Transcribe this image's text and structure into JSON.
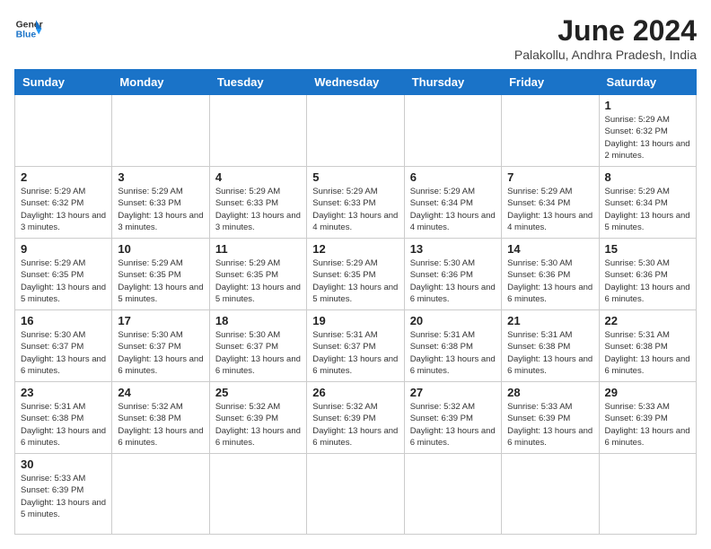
{
  "logo": {
    "line1": "General",
    "line2": "Blue"
  },
  "title": "June 2024",
  "subtitle": "Palakollu, Andhra Pradesh, India",
  "days_of_week": [
    "Sunday",
    "Monday",
    "Tuesday",
    "Wednesday",
    "Thursday",
    "Friday",
    "Saturday"
  ],
  "weeks": [
    [
      {
        "day": "",
        "info": ""
      },
      {
        "day": "",
        "info": ""
      },
      {
        "day": "",
        "info": ""
      },
      {
        "day": "",
        "info": ""
      },
      {
        "day": "",
        "info": ""
      },
      {
        "day": "",
        "info": ""
      },
      {
        "day": "1",
        "info": "Sunrise: 5:29 AM\nSunset: 6:32 PM\nDaylight: 13 hours and 2 minutes."
      }
    ],
    [
      {
        "day": "2",
        "info": "Sunrise: 5:29 AM\nSunset: 6:32 PM\nDaylight: 13 hours and 3 minutes."
      },
      {
        "day": "3",
        "info": "Sunrise: 5:29 AM\nSunset: 6:33 PM\nDaylight: 13 hours and 3 minutes."
      },
      {
        "day": "4",
        "info": "Sunrise: 5:29 AM\nSunset: 6:33 PM\nDaylight: 13 hours and 3 minutes."
      },
      {
        "day": "5",
        "info": "Sunrise: 5:29 AM\nSunset: 6:33 PM\nDaylight: 13 hours and 4 minutes."
      },
      {
        "day": "6",
        "info": "Sunrise: 5:29 AM\nSunset: 6:34 PM\nDaylight: 13 hours and 4 minutes."
      },
      {
        "day": "7",
        "info": "Sunrise: 5:29 AM\nSunset: 6:34 PM\nDaylight: 13 hours and 4 minutes."
      },
      {
        "day": "8",
        "info": "Sunrise: 5:29 AM\nSunset: 6:34 PM\nDaylight: 13 hours and 5 minutes."
      }
    ],
    [
      {
        "day": "9",
        "info": "Sunrise: 5:29 AM\nSunset: 6:35 PM\nDaylight: 13 hours and 5 minutes."
      },
      {
        "day": "10",
        "info": "Sunrise: 5:29 AM\nSunset: 6:35 PM\nDaylight: 13 hours and 5 minutes."
      },
      {
        "day": "11",
        "info": "Sunrise: 5:29 AM\nSunset: 6:35 PM\nDaylight: 13 hours and 5 minutes."
      },
      {
        "day": "12",
        "info": "Sunrise: 5:29 AM\nSunset: 6:35 PM\nDaylight: 13 hours and 5 minutes."
      },
      {
        "day": "13",
        "info": "Sunrise: 5:30 AM\nSunset: 6:36 PM\nDaylight: 13 hours and 6 minutes."
      },
      {
        "day": "14",
        "info": "Sunrise: 5:30 AM\nSunset: 6:36 PM\nDaylight: 13 hours and 6 minutes."
      },
      {
        "day": "15",
        "info": "Sunrise: 5:30 AM\nSunset: 6:36 PM\nDaylight: 13 hours and 6 minutes."
      }
    ],
    [
      {
        "day": "16",
        "info": "Sunrise: 5:30 AM\nSunset: 6:37 PM\nDaylight: 13 hours and 6 minutes."
      },
      {
        "day": "17",
        "info": "Sunrise: 5:30 AM\nSunset: 6:37 PM\nDaylight: 13 hours and 6 minutes."
      },
      {
        "day": "18",
        "info": "Sunrise: 5:30 AM\nSunset: 6:37 PM\nDaylight: 13 hours and 6 minutes."
      },
      {
        "day": "19",
        "info": "Sunrise: 5:31 AM\nSunset: 6:37 PM\nDaylight: 13 hours and 6 minutes."
      },
      {
        "day": "20",
        "info": "Sunrise: 5:31 AM\nSunset: 6:38 PM\nDaylight: 13 hours and 6 minutes."
      },
      {
        "day": "21",
        "info": "Sunrise: 5:31 AM\nSunset: 6:38 PM\nDaylight: 13 hours and 6 minutes."
      },
      {
        "day": "22",
        "info": "Sunrise: 5:31 AM\nSunset: 6:38 PM\nDaylight: 13 hours and 6 minutes."
      }
    ],
    [
      {
        "day": "23",
        "info": "Sunrise: 5:31 AM\nSunset: 6:38 PM\nDaylight: 13 hours and 6 minutes."
      },
      {
        "day": "24",
        "info": "Sunrise: 5:32 AM\nSunset: 6:38 PM\nDaylight: 13 hours and 6 minutes."
      },
      {
        "day": "25",
        "info": "Sunrise: 5:32 AM\nSunset: 6:39 PM\nDaylight: 13 hours and 6 minutes."
      },
      {
        "day": "26",
        "info": "Sunrise: 5:32 AM\nSunset: 6:39 PM\nDaylight: 13 hours and 6 minutes."
      },
      {
        "day": "27",
        "info": "Sunrise: 5:32 AM\nSunset: 6:39 PM\nDaylight: 13 hours and 6 minutes."
      },
      {
        "day": "28",
        "info": "Sunrise: 5:33 AM\nSunset: 6:39 PM\nDaylight: 13 hours and 6 minutes."
      },
      {
        "day": "29",
        "info": "Sunrise: 5:33 AM\nSunset: 6:39 PM\nDaylight: 13 hours and 6 minutes."
      }
    ],
    [
      {
        "day": "30",
        "info": "Sunrise: 5:33 AM\nSunset: 6:39 PM\nDaylight: 13 hours and 5 minutes."
      },
      {
        "day": "",
        "info": ""
      },
      {
        "day": "",
        "info": ""
      },
      {
        "day": "",
        "info": ""
      },
      {
        "day": "",
        "info": ""
      },
      {
        "day": "",
        "info": ""
      },
      {
        "day": "",
        "info": ""
      }
    ]
  ]
}
